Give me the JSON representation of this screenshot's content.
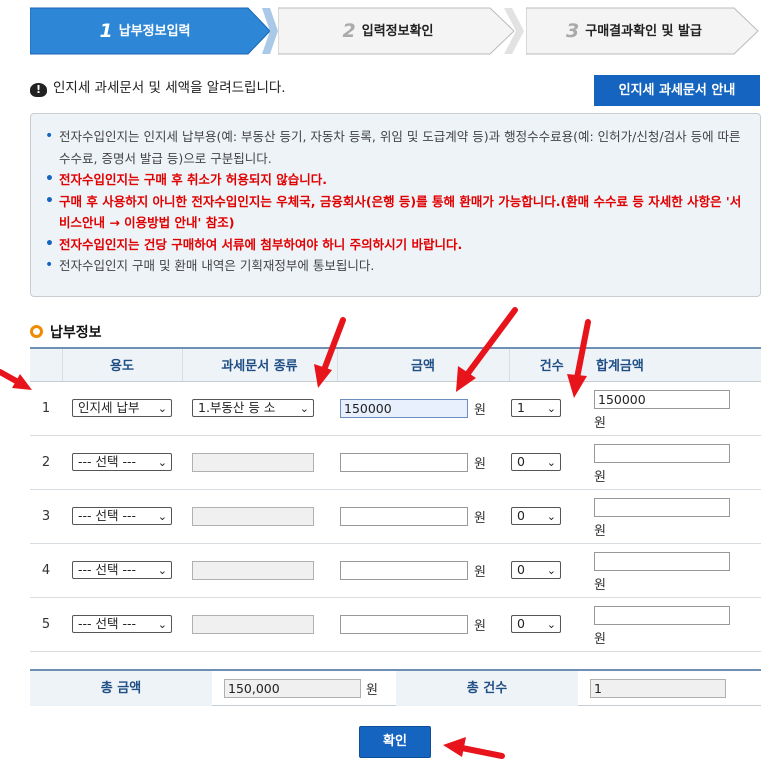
{
  "steps": [
    {
      "num": "1",
      "label": "납부정보입력",
      "active": true
    },
    {
      "num": "2",
      "label": "입력정보확인",
      "active": false
    },
    {
      "num": "3",
      "label": "구매결과확인 및 발급",
      "active": false
    }
  ],
  "notice": {
    "icon": "exclamation-bubble-icon",
    "heading": "인지세 과세문서 및 세액을 알려드립니다.",
    "guide_button": "인지세 과세문서 안내"
  },
  "info_items": [
    {
      "text": "전자수입인지는 인지세 납부용(예: 부동산 등기, 자동차 등록, 위임 및 도급계약 등)과 행정수수료용(예: 인허가/신청/검사 등에 따른 수수료, 증명서 발급 등)으로 구분됩니다.",
      "red": false
    },
    {
      "text": "전자수입인지는 구매 후 취소가 허용되지 않습니다.",
      "red": true
    },
    {
      "text": "구매 후 사용하지 아니한 전자수입인지는 우체국, 금융회사(은행 등)를 통해 환매가 가능합니다.(환매 수수료 등 자세한 사항은 '서비스안내 → 이용방법 안내' 참조)",
      "red": true
    },
    {
      "text": "전자수입인지는 건당 구매하여 서류에 첨부하여야 하니 주의하시기 바랍니다.",
      "red": true
    },
    {
      "text": "전자수입인지 구매 및 환매 내역은 기획재정부에 통보됩니다.",
      "red": false
    }
  ],
  "section_title": "납부정보",
  "table": {
    "headers": {
      "usage": "용도",
      "doc_type": "과세문서 종류",
      "amount": "금액",
      "count": "건수",
      "total": "합계금액"
    },
    "unit": "원",
    "rows": [
      {
        "no": "1",
        "usage": "인지세 납부",
        "doc_type": "1.부동산 등 소",
        "amount": "150000",
        "count": "1",
        "total": "150000"
      },
      {
        "no": "2",
        "usage": "--- 선택 ---",
        "doc_type": "",
        "amount": "",
        "count": "0",
        "total": ""
      },
      {
        "no": "3",
        "usage": "--- 선택 ---",
        "doc_type": "",
        "amount": "",
        "count": "0",
        "total": ""
      },
      {
        "no": "4",
        "usage": "--- 선택 ---",
        "doc_type": "",
        "amount": "",
        "count": "0",
        "total": ""
      },
      {
        "no": "5",
        "usage": "--- 선택 ---",
        "doc_type": "",
        "amount": "",
        "count": "0",
        "total": ""
      }
    ]
  },
  "totals": {
    "amount_label": "총 금액",
    "amount_value": "150,000",
    "unit": "원",
    "count_label": "총 건수",
    "count_value": "1"
  },
  "confirm_button": "확인",
  "colors": {
    "primary": "#1565c0",
    "warning_text": "#e00000",
    "annotation_arrow": "#e8141b",
    "header_bg": "#eef3f8"
  }
}
